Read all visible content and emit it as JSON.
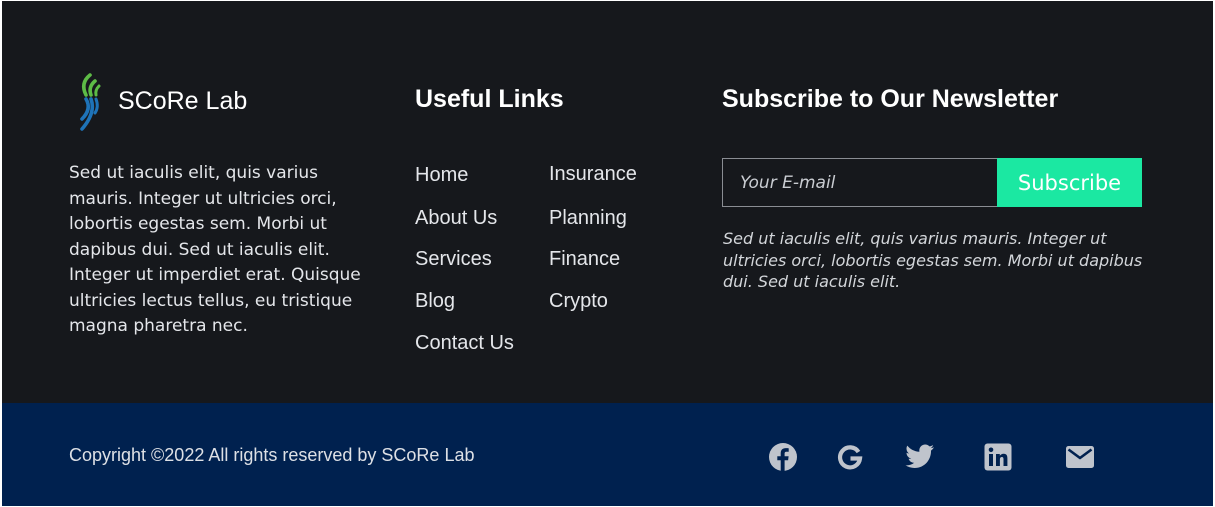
{
  "brand": {
    "name": "SCoRe Lab",
    "logo_icon": "score-lab-logo-icon",
    "colors": {
      "green": "#5dbb46",
      "blue": "#1e73b8"
    },
    "about": "Sed ut iaculis elit, quis varius mauris. Integer ut ultricies orci, lobortis egestas sem. Morbi ut dapibus dui. Sed ut iaculis elit. Integer ut imperdiet erat. Quisque ultricies lectus tellus, eu tristique magna pharetra nec."
  },
  "useful_links": {
    "heading": "Useful Links",
    "column_1": [
      "Home",
      "About Us",
      "Services",
      "Blog",
      "Contact Us"
    ],
    "column_2": [
      "Insurance",
      "Planning",
      "Finance",
      "Crypto"
    ]
  },
  "newsletter": {
    "heading": "Subscribe to Our Newsletter",
    "email_placeholder": "Your E-mail",
    "email_value": "",
    "button_label": "Subscribe",
    "button_color": "#1be8a2",
    "description": "Sed ut iaculis elit, quis varius mauris. Integer ut ultricies orci, lobortis egestas sem. Morbi ut dapibus dui. Sed ut iaculis elit."
  },
  "bottom_bar": {
    "copyright": "Copyright ©2022 All rights reserved by SCoRe Lab",
    "background": "#00214f",
    "social_icons": [
      "facebook-icon",
      "google-icon",
      "twitter-icon",
      "linkedin-icon",
      "mail-icon"
    ]
  },
  "theme": {
    "top_background": "#16181c",
    "icon_color": "#bfc4cc"
  }
}
